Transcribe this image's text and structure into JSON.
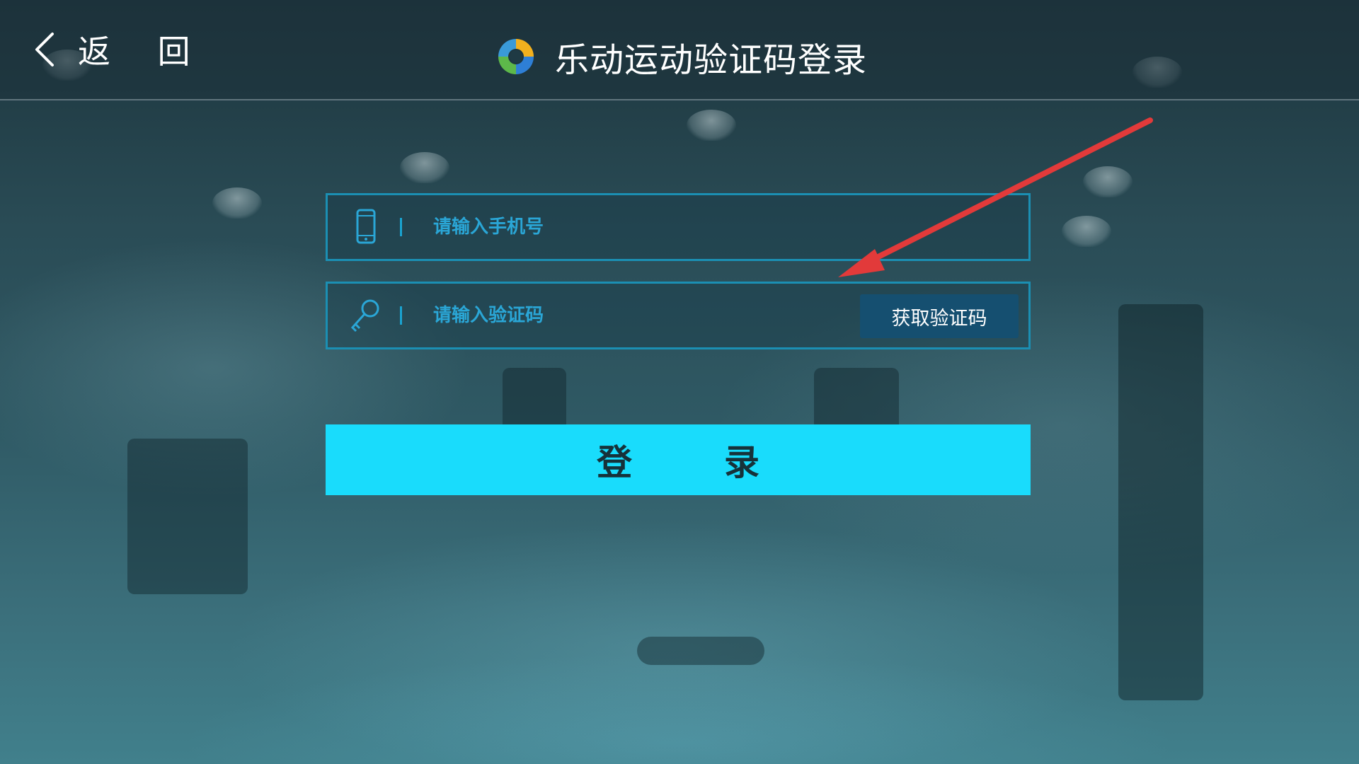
{
  "header": {
    "back_label": "返 回",
    "title": "乐动运动验证码登录"
  },
  "form": {
    "phone": {
      "placeholder": "请输入手机号",
      "value": ""
    },
    "code": {
      "placeholder": "请输入验证码",
      "value": "",
      "get_code_label": "获取验证码"
    },
    "login_label": "登录"
  },
  "icons": {
    "back": "chevron-left-icon",
    "logo": "app-logo-icon",
    "phone": "mobile-phone-icon",
    "code": "key-icon",
    "annotation": "red-arrow-icon"
  },
  "colors": {
    "accent": "#19dcfc",
    "field_border": "#1b8fb3",
    "placeholder": "#2aa6d6",
    "code_button": "#154f70",
    "annotation_arrow": "#e23a3a"
  }
}
